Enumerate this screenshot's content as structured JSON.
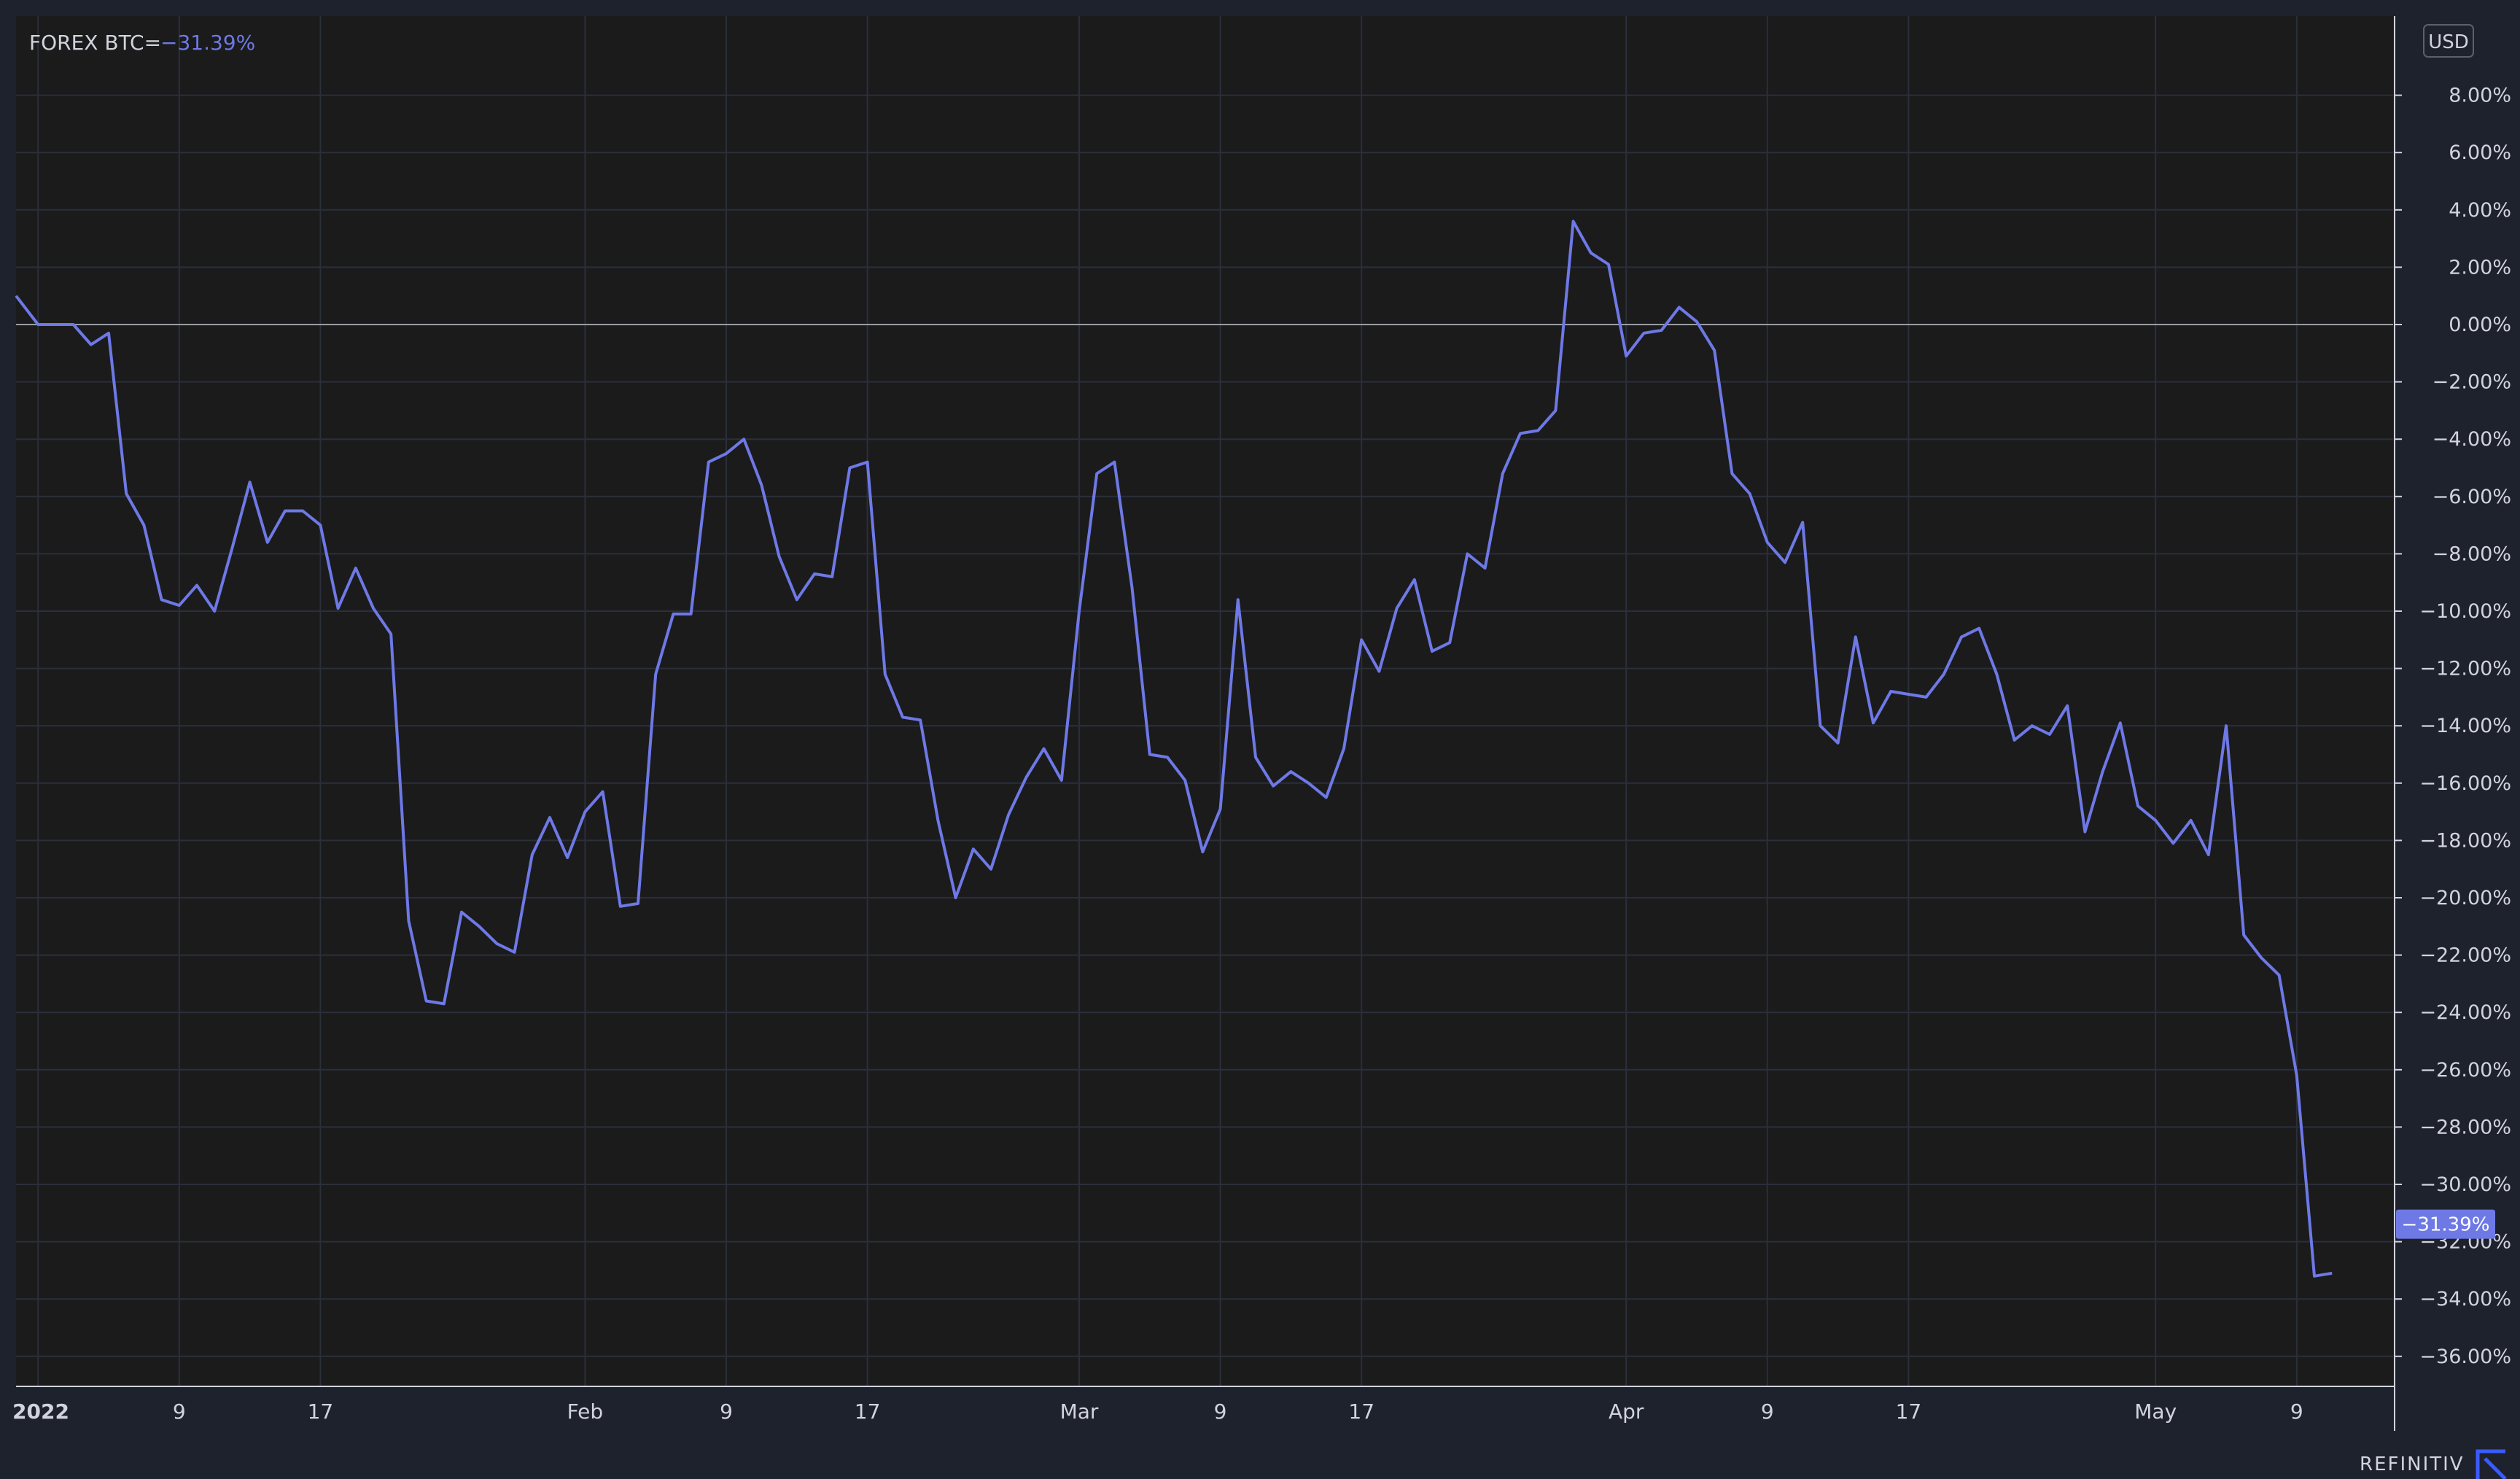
{
  "legend": {
    "symbol": "FOREX BTC=",
    "change": "−31.39%"
  },
  "currency_label": "USD",
  "brand": "REFINITIV",
  "colors": {
    "background": "#1e222d",
    "plot_background": "#1b1b1c",
    "series": "#6e79e6",
    "grid": "#2b2f3a",
    "zero_line": "#9a9ca3",
    "text": "#d1d4dc"
  },
  "chart_data": {
    "type": "line",
    "x_axis_type": "time",
    "x": [
      "2022-01-01",
      "2022-01-02",
      "2022-01-03",
      "2022-01-04",
      "2022-01-05",
      "2022-01-06",
      "2022-01-07",
      "2022-01-08",
      "2022-01-09",
      "2022-01-10",
      "2022-01-11",
      "2022-01-12",
      "2022-01-13",
      "2022-01-14",
      "2022-01-15",
      "2022-01-16",
      "2022-01-17",
      "2022-01-18",
      "2022-01-19",
      "2022-01-20",
      "2022-01-21",
      "2022-01-22",
      "2022-01-23",
      "2022-01-24",
      "2022-01-25",
      "2022-01-26",
      "2022-01-27",
      "2022-01-28",
      "2022-01-29",
      "2022-01-30",
      "2022-01-31",
      "2022-02-01",
      "2022-02-02",
      "2022-02-03",
      "2022-02-04",
      "2022-02-05",
      "2022-02-06",
      "2022-02-07",
      "2022-02-08",
      "2022-02-09",
      "2022-02-10",
      "2022-02-11",
      "2022-02-12",
      "2022-02-13",
      "2022-02-14",
      "2022-02-15",
      "2022-02-16",
      "2022-02-17",
      "2022-02-18",
      "2022-02-19",
      "2022-02-20",
      "2022-02-21",
      "2022-02-22",
      "2022-02-23",
      "2022-02-24",
      "2022-02-25",
      "2022-02-26",
      "2022-02-27",
      "2022-02-28",
      "2022-03-01",
      "2022-03-02",
      "2022-03-03",
      "2022-03-04",
      "2022-03-05",
      "2022-03-06",
      "2022-03-07",
      "2022-03-08",
      "2022-03-09",
      "2022-03-10",
      "2022-03-11",
      "2022-03-12",
      "2022-03-13",
      "2022-03-14",
      "2022-03-15",
      "2022-03-16",
      "2022-03-17",
      "2022-03-18",
      "2022-03-19",
      "2022-03-20",
      "2022-03-21",
      "2022-03-22",
      "2022-03-23",
      "2022-03-24",
      "2022-03-25",
      "2022-03-26",
      "2022-03-27",
      "2022-03-28",
      "2022-03-29",
      "2022-03-30",
      "2022-03-31",
      "2022-04-01",
      "2022-04-02",
      "2022-04-03",
      "2022-04-04",
      "2022-04-05",
      "2022-04-06",
      "2022-04-07",
      "2022-04-08",
      "2022-04-09",
      "2022-04-10",
      "2022-04-11",
      "2022-04-12",
      "2022-04-13",
      "2022-04-14",
      "2022-04-15",
      "2022-04-16",
      "2022-04-17",
      "2022-04-18",
      "2022-04-19",
      "2022-04-20",
      "2022-04-21",
      "2022-04-22",
      "2022-04-23",
      "2022-04-24",
      "2022-04-25",
      "2022-04-26",
      "2022-04-27",
      "2022-04-28",
      "2022-04-29",
      "2022-04-30",
      "2022-05-01",
      "2022-05-02",
      "2022-05-03",
      "2022-05-04",
      "2022-05-05",
      "2022-05-06",
      "2022-05-07",
      "2022-05-08",
      "2022-05-09",
      "2022-05-10",
      "2022-05-11"
    ],
    "series": [
      {
        "values": [
          0.0,
          0.0,
          0.0,
          -0.7,
          -0.3,
          -5.9,
          -7.0,
          -9.6,
          -9.8,
          -9.1,
          -10.0,
          -7.8,
          -5.5,
          -7.6,
          -6.5,
          -6.5,
          -7.0,
          -9.9,
          -8.5,
          -9.9,
          -10.8,
          -20.8,
          -23.6,
          -23.7,
          -20.5,
          -21.0,
          -21.6,
          -21.9,
          -18.5,
          -17.2,
          -18.6,
          -17.0,
          -16.3,
          -20.3,
          -20.2,
          -12.2,
          -10.1,
          -10.1,
          -4.8,
          -4.5,
          -4.0,
          -5.6,
          -8.1,
          -9.6,
          -8.7,
          -8.8,
          -5.0,
          -4.8,
          -12.2,
          -13.7,
          -13.8,
          -17.3,
          -20.0,
          -18.3,
          -19.0,
          -17.1,
          -15.8,
          -14.8,
          -15.9,
          -10.0,
          -5.2,
          -4.8,
          -9.2,
          -15.0,
          -15.1,
          -15.9,
          -18.4,
          -16.9,
          -9.6,
          -15.1,
          -16.1,
          -15.6,
          -16.0,
          -16.5,
          -14.8,
          -11.0,
          -12.1,
          -9.9,
          -8.9,
          -11.4,
          -11.1,
          -8.0,
          -8.5,
          -5.2,
          -3.8,
          -3.7,
          -3.0,
          3.6,
          2.5,
          2.1,
          -1.1,
          -0.3,
          -0.2,
          0.6,
          0.1,
          -0.9,
          -5.2,
          -5.9,
          -7.6,
          -8.3,
          -6.9,
          -14.0,
          -14.6,
          -10.9,
          -13.9,
          -12.8,
          -12.9,
          -13.0,
          -12.2,
          -10.9,
          -10.6,
          -12.2,
          -14.5,
          -14.0,
          -14.3,
          -13.3,
          -17.7,
          -15.6,
          -13.9,
          -16.8,
          -17.3,
          -18.1,
          -17.3,
          -18.5,
          -14.0,
          -21.3,
          -22.1,
          -22.7,
          -26.2,
          -33.2,
          -33.1,
          -31.39
        ]
      }
    ],
    "y_unit": "%",
    "ylim": [
      -37,
      10
    ],
    "y_ticks": [
      "8.00%",
      "6.00%",
      "4.00%",
      "2.00%",
      "0.00%",
      "−2.00%",
      "−4.00%",
      "−6.00%",
      "−8.00%",
      "−10.00%",
      "−12.00%",
      "−14.00%",
      "−16.00%",
      "−18.00%",
      "−20.00%",
      "−22.00%",
      "−24.00%",
      "−26.00%",
      "−28.00%",
      "−30.00%",
      "−32.00%",
      "−34.00%",
      "−36.00%"
    ],
    "y_tick_values": [
      8,
      6,
      4,
      2,
      0,
      -2,
      -4,
      -6,
      -8,
      -10,
      -12,
      -14,
      -16,
      -18,
      -20,
      -22,
      -24,
      -26,
      -28,
      -30,
      -32,
      -34,
      -36
    ],
    "x_ticks": [
      {
        "date": "2022-01-01",
        "label": "2022",
        "bold": true
      },
      {
        "date": "2022-01-09",
        "label": "9"
      },
      {
        "date": "2022-01-17",
        "label": "17"
      },
      {
        "date": "2022-02-01",
        "label": "Feb"
      },
      {
        "date": "2022-02-09",
        "label": "9"
      },
      {
        "date": "2022-02-17",
        "label": "17"
      },
      {
        "date": "2022-03-01",
        "label": "Mar"
      },
      {
        "date": "2022-03-09",
        "label": "9"
      },
      {
        "date": "2022-03-17",
        "label": "17"
      },
      {
        "date": "2022-04-01",
        "label": "Apr"
      },
      {
        "date": "2022-04-09",
        "label": "9"
      },
      {
        "date": "2022-04-17",
        "label": "17"
      },
      {
        "date": "2022-05-01",
        "label": "May"
      },
      {
        "date": "2022-05-09",
        "label": "9"
      }
    ],
    "last_value_label": "−31.39%",
    "reference_line": 0,
    "grid": true
  }
}
